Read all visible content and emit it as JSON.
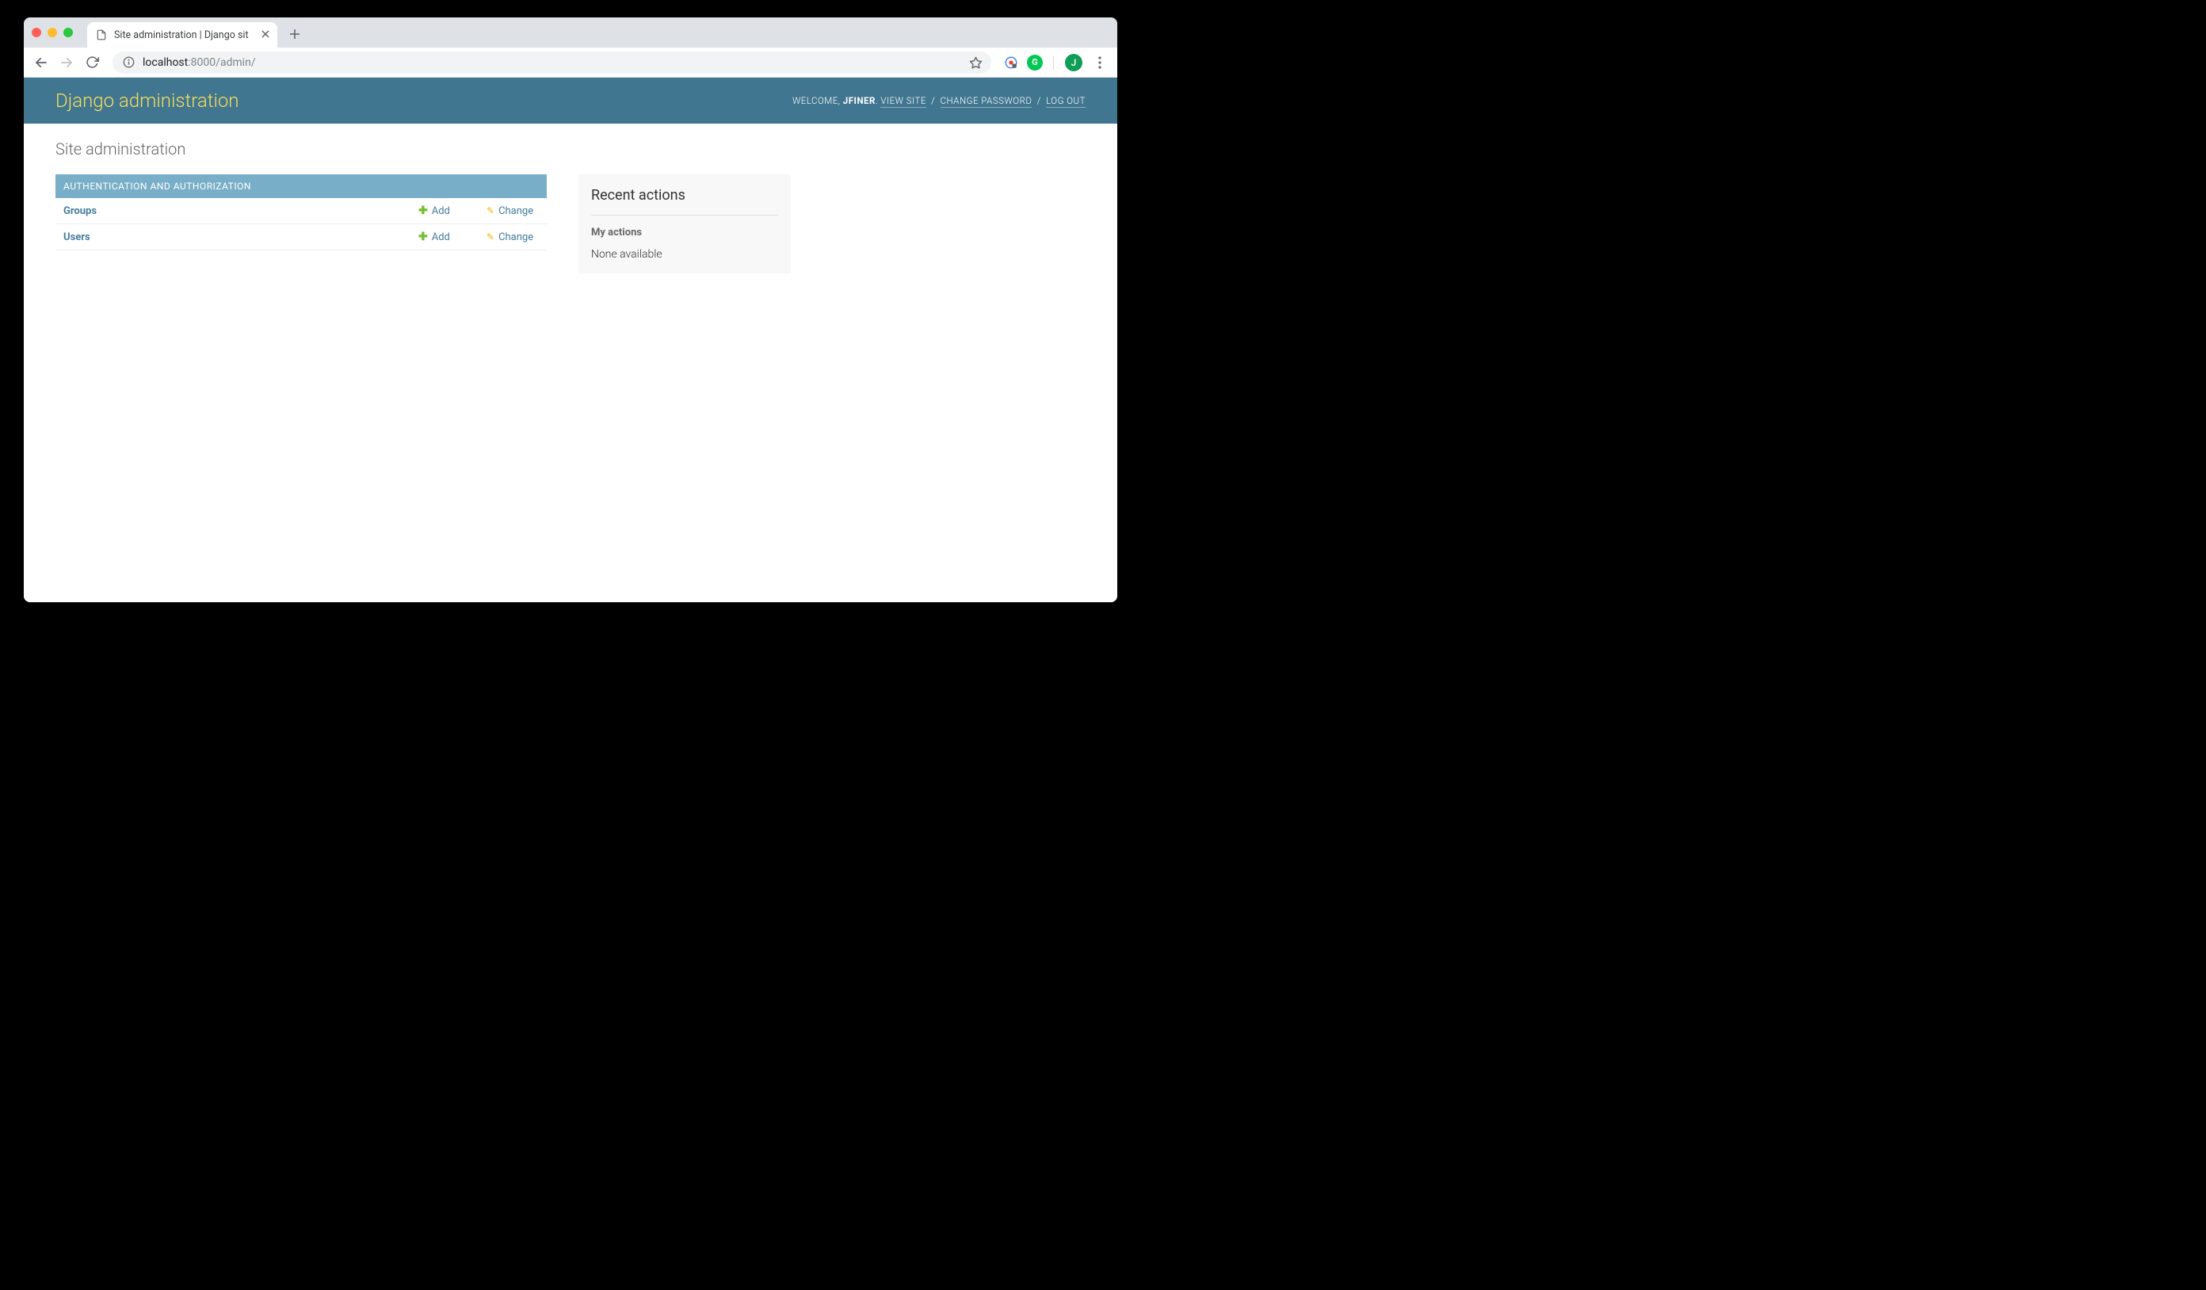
{
  "browser": {
    "tab_title": "Site administration | Django sit",
    "url_host": "localhost",
    "url_port_path": ":8000/admin/",
    "avatar_initial": "J"
  },
  "header": {
    "title": "Django administration",
    "welcome": "WELCOME, ",
    "username": "JFINER",
    "view_site": "VIEW SITE",
    "change_password": "CHANGE PASSWORD",
    "logout": "LOG OUT"
  },
  "page": {
    "heading": "Site administration"
  },
  "modules": [
    {
      "caption": "AUTHENTICATION AND AUTHORIZATION",
      "models": [
        {
          "name": "Groups",
          "add_label": "Add",
          "change_label": "Change"
        },
        {
          "name": "Users",
          "add_label": "Add",
          "change_label": "Change"
        }
      ]
    }
  ],
  "sidebar": {
    "heading": "Recent actions",
    "subheading": "My actions",
    "empty": "None available"
  }
}
